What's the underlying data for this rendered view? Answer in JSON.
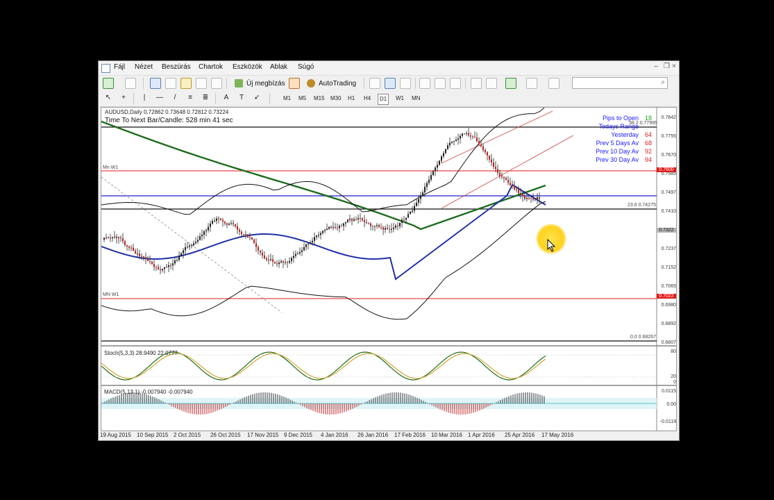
{
  "menu": [
    "Fájl",
    "Nézet",
    "Beszúrás",
    "Chartok",
    "Eszközök",
    "Ablak",
    "Súgó"
  ],
  "toolbar": {
    "new_order": "Új megbízás",
    "autotrading": "AutoTrading"
  },
  "timeframes": [
    "M1",
    "M5",
    "M15",
    "M30",
    "H1",
    "H4",
    "D1",
    "W1",
    "MN"
  ],
  "active_timeframe": "D1",
  "chart": {
    "header": "AUDUSD,Daily  0.72862 0.73648 0.72812 0.73224",
    "timer": "Time To Next Bar/Candle: 528 min 41 sec",
    "mn_label_top": "Mn W1",
    "mn_label_bottom": "MN W1",
    "fib_236": "23.6 0.74275",
    "fib_382": "38.2 0.77995",
    "fib_0": "0.0 0.68267"
  },
  "pips_panel": [
    {
      "label": "Pips to Open",
      "value": "18"
    },
    {
      "label": "Todays Range",
      "value": ""
    },
    {
      "label": "Yesterday",
      "value": "64"
    },
    {
      "label": "Prev 5 Days Av",
      "value": "68"
    },
    {
      "label": "Prev 10 Day Av",
      "value": "92"
    },
    {
      "label": "Prev 30 Day Av",
      "value": "94"
    }
  ],
  "price_scale": [
    "0.7842",
    "0.7755",
    "0.7670",
    "0.7585",
    "0.7497",
    "0.7410",
    "0.7323",
    "0.7237",
    "0.7152",
    "0.7065",
    "0.6980",
    "0.6892",
    "0.6807"
  ],
  "price_tags": {
    "red_top": "0.7600",
    "current": "0.7322",
    "red_bottom": "0.7022"
  },
  "stoch": {
    "header": "Stoch(5,3,3) 28.9490 22.0777",
    "levels": [
      "80",
      "20",
      "0"
    ]
  },
  "macd": {
    "header": "MACD(5,13,1) -0.007940 -0.007940",
    "levels": [
      "0.0115",
      "0.00",
      "-0.0119"
    ]
  },
  "dates": [
    "19 Aug 2015",
    "10 Sep 2015",
    "2 Oct 2015",
    "26 Oct 2015",
    "17 Nov 2015",
    "9 Dec 2015",
    "4 Jan 2016",
    "26 Jan 2016",
    "17 Feb 2016",
    "10 Mar 2016",
    "1 Apr 2016",
    "25 Apr 2016",
    "17 May 2016"
  ],
  "colors": {
    "ma_long": "#1e6b1e",
    "ma_mid": "#1f2fa5",
    "level_red": "#e31a1a",
    "level_blue": "#1f1fd0",
    "stoch_main": "#1e6b1e",
    "stoch_signal": "#d4a72c",
    "macd_hist": "#333333",
    "cursor": "#ffd21e"
  }
}
